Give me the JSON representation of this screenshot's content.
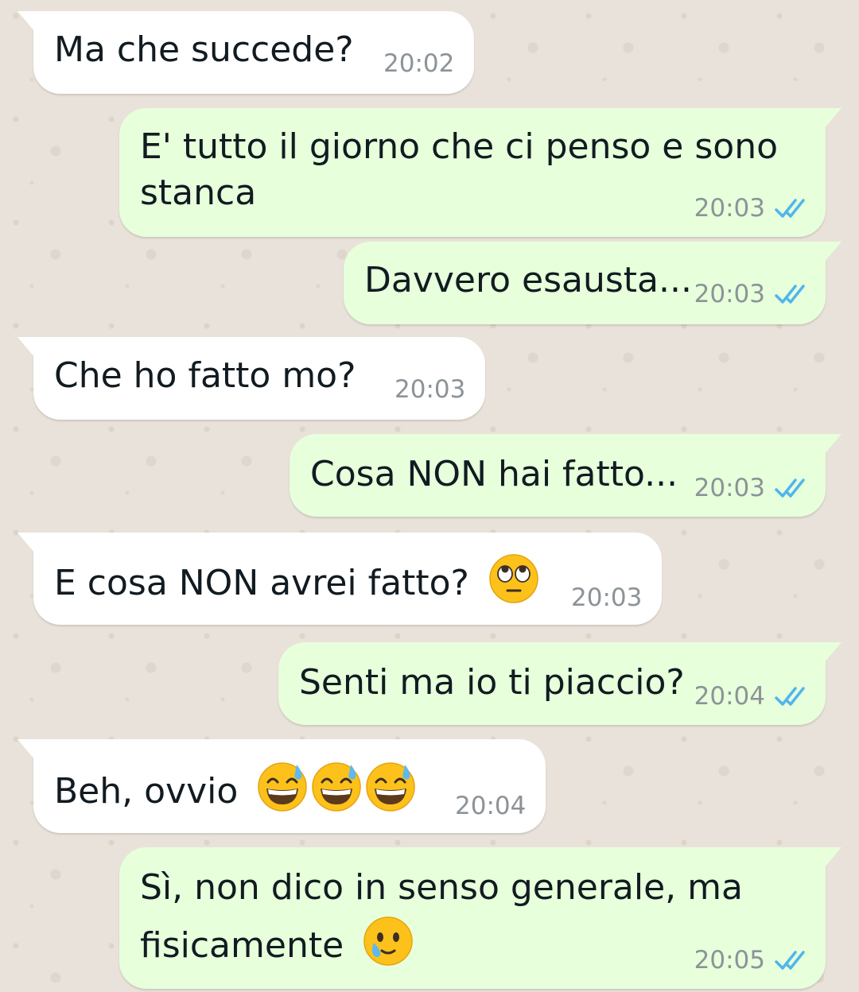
{
  "colors": {
    "incoming_bubble": "#ffffff",
    "outgoing_bubble": "#e7ffdb",
    "read_ticks": "#4fb6ec",
    "timestamp": "#8c9398",
    "wallpaper": "#e9e2da"
  },
  "messages": [
    {
      "direction": "incoming",
      "lines": [
        "Ma che succede?"
      ],
      "time": "20:02"
    },
    {
      "direction": "outgoing",
      "lines": [
        "E' tutto il giorno che ci penso e sono",
        "stanca"
      ],
      "time": "20:03",
      "status_icon": "double-check-icon"
    },
    {
      "direction": "outgoing",
      "lines": [
        "Davvero esausta..."
      ],
      "time": "20:03",
      "status_icon": "double-check-icon"
    },
    {
      "direction": "incoming",
      "lines": [
        "Che ho fatto mo?"
      ],
      "time": "20:03"
    },
    {
      "direction": "outgoing",
      "lines": [
        "Cosa NON hai fatto..."
      ],
      "time": "20:03",
      "status_icon": "double-check-icon"
    },
    {
      "direction": "incoming",
      "lines": [
        "E cosa NON avrei fatto?"
      ],
      "emojis": [
        "face-with-rolling-eyes"
      ],
      "time": "20:03"
    },
    {
      "direction": "outgoing",
      "lines": [
        "Senti ma io ti piaccio?"
      ],
      "time": "20:04",
      "status_icon": "double-check-icon"
    },
    {
      "direction": "incoming",
      "lines": [
        "Beh, ovvio"
      ],
      "emojis": [
        "grinning-face-with-sweat",
        "grinning-face-with-sweat",
        "grinning-face-with-sweat"
      ],
      "time": "20:04"
    },
    {
      "direction": "outgoing",
      "lines": [
        "Sì, non dico in senso generale, ma",
        "fisicamente"
      ],
      "emojis": [
        "face-holding-back-tears"
      ],
      "time": "20:05",
      "status_icon": "double-check-icon"
    }
  ]
}
